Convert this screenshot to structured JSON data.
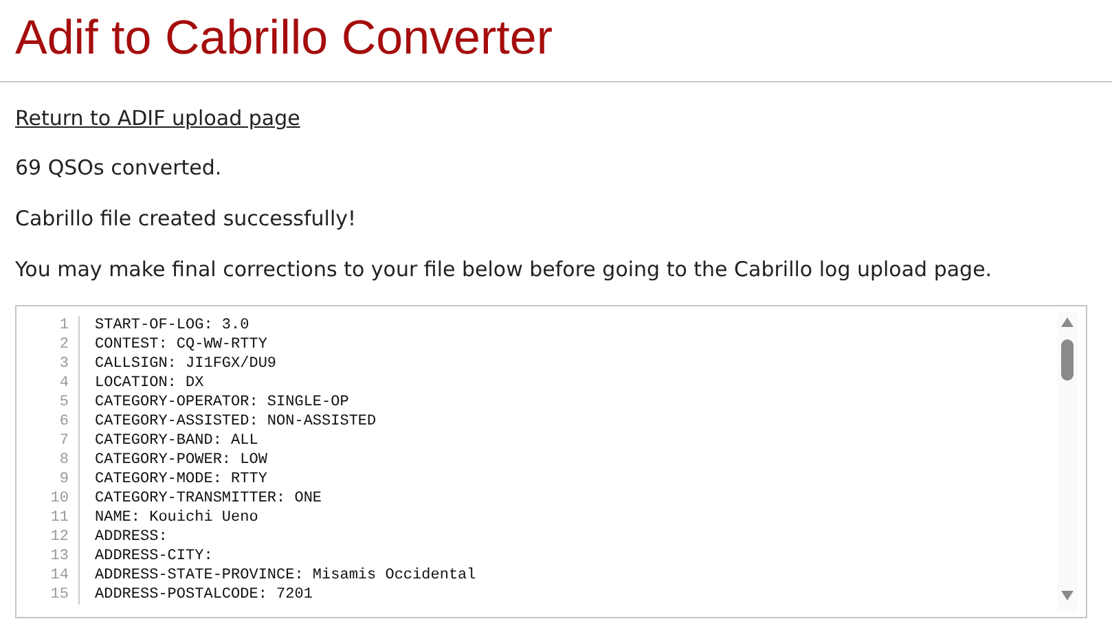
{
  "title": "Adif to Cabrillo Converter",
  "link": "Return to ADIF upload page",
  "messages": [
    "69 QSOs converted.",
    "Cabrillo file created successfully!",
    "You may make final corrections to your file below before going to the Cabrillo log upload page."
  ],
  "editor": {
    "lines": [
      {
        "number": "1",
        "text": "START-OF-LOG: 3.0"
      },
      {
        "number": "2",
        "text": "CONTEST: CQ-WW-RTTY"
      },
      {
        "number": "3",
        "text": "CALLSIGN: JI1FGX/DU9"
      },
      {
        "number": "4",
        "text": "LOCATION: DX"
      },
      {
        "number": "5",
        "text": "CATEGORY-OPERATOR: SINGLE-OP"
      },
      {
        "number": "6",
        "text": "CATEGORY-ASSISTED: NON-ASSISTED"
      },
      {
        "number": "7",
        "text": "CATEGORY-BAND: ALL"
      },
      {
        "number": "8",
        "text": "CATEGORY-POWER: LOW"
      },
      {
        "number": "9",
        "text": "CATEGORY-MODE: RTTY"
      },
      {
        "number": "10",
        "text": "CATEGORY-TRANSMITTER: ONE"
      },
      {
        "number": "11",
        "text": "NAME: Kouichi Ueno"
      },
      {
        "number": "12",
        "text": "ADDRESS:"
      },
      {
        "number": "13",
        "text": "ADDRESS-CITY:"
      },
      {
        "number": "14",
        "text": "ADDRESS-STATE-PROVINCE: Misamis Occidental"
      },
      {
        "number": "15",
        "text": "ADDRESS-POSTALCODE: 7201"
      }
    ]
  }
}
